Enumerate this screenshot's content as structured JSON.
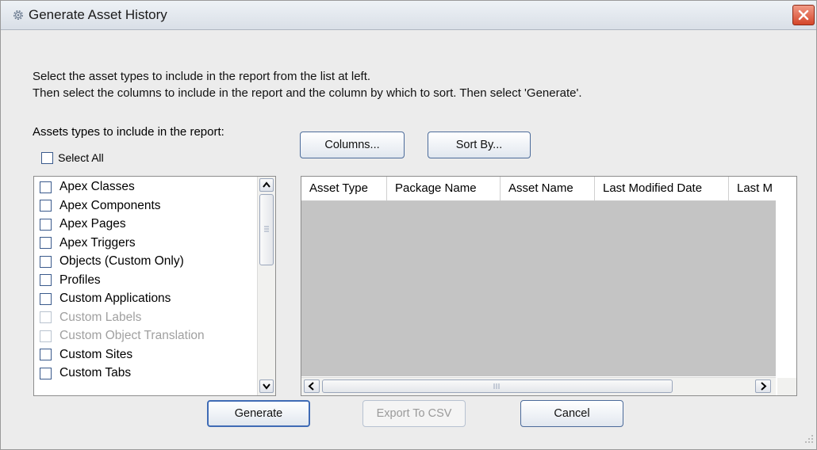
{
  "window": {
    "title": "Generate Asset History",
    "title_icon": "gear-icon"
  },
  "instructions": {
    "line1": "Select the asset types to include in the report from the list at left.",
    "line2": "Then select the columns to include in the report and the column by which to sort. Then select 'Generate'."
  },
  "assets_label": "Assets types to include in the report:",
  "select_all": {
    "label": "Select All",
    "checked": false
  },
  "asset_list": [
    {
      "label": "Apex Classes",
      "enabled": true,
      "checked": false
    },
    {
      "label": "Apex Components",
      "enabled": true,
      "checked": false
    },
    {
      "label": "Apex Pages",
      "enabled": true,
      "checked": false
    },
    {
      "label": "Apex Triggers",
      "enabled": true,
      "checked": false
    },
    {
      "label": "Objects (Custom Only)",
      "enabled": true,
      "checked": false
    },
    {
      "label": "Profiles",
      "enabled": true,
      "checked": false
    },
    {
      "label": "Custom Applications",
      "enabled": true,
      "checked": false
    },
    {
      "label": "Custom Labels",
      "enabled": false,
      "checked": false
    },
    {
      "label": "Custom Object Translation",
      "enabled": false,
      "checked": false
    },
    {
      "label": "Custom Sites",
      "enabled": true,
      "checked": false
    },
    {
      "label": "Custom Tabs",
      "enabled": true,
      "checked": false
    }
  ],
  "toolbar": {
    "columns_label": "Columns...",
    "sort_by_label": "Sort By..."
  },
  "table": {
    "columns": [
      "Asset Type",
      "Package Name",
      "Asset Name",
      "Last Modified Date",
      "Last M"
    ],
    "rows": []
  },
  "actions": {
    "generate_label": "Generate",
    "export_label": "Export To CSV",
    "export_enabled": false,
    "cancel_label": "Cancel"
  },
  "colors": {
    "disabled_text": "#a0a0a0",
    "table_empty_bg": "#c4c4c4",
    "close_button": "#d4462a"
  }
}
